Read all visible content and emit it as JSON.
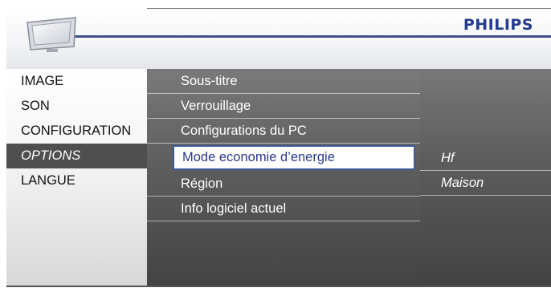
{
  "header": {
    "brand": "PHILIPS"
  },
  "icons": {
    "tv": "tv-screen-icon"
  },
  "colors": {
    "brand": "#243c8c",
    "header_rule": "#3f4f8a",
    "highlight_text": "#2b3a8a"
  },
  "menu": {
    "categories": [
      "IMAGE",
      "SON",
      "CONFIGURATION",
      "OPTIONS",
      "LANGUE"
    ],
    "active_category": "OPTIONS",
    "options": [
      "Sous-titre",
      "Verrouillage",
      "Configurations du PC",
      "Mode economie d’energie",
      "Région",
      "Info logiciel actuel"
    ],
    "selected_option": "Mode economie d’energie",
    "values": [
      "Hf",
      "Maison"
    ]
  }
}
